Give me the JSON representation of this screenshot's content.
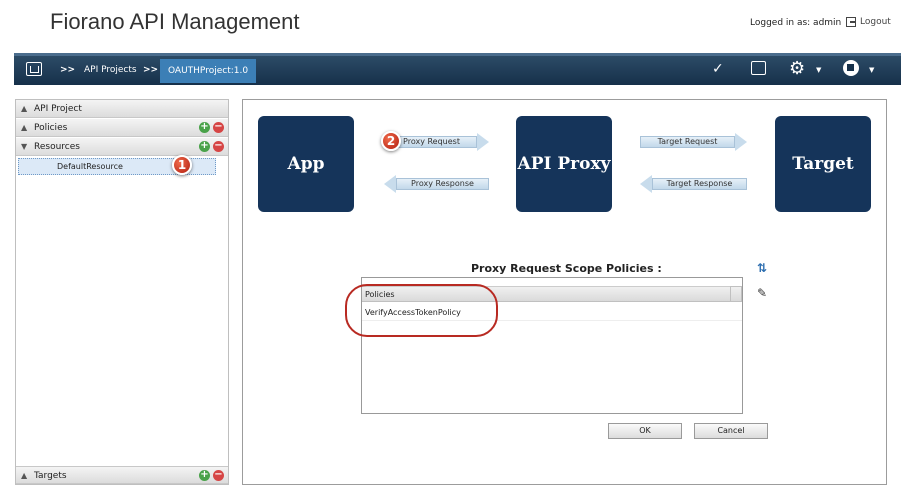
{
  "header": {
    "title": "Fiorano API Management",
    "logged_in": "Logged in as: admin",
    "logout": "Logout"
  },
  "navbar": {
    "crumb_sep": ">>",
    "crumbs": [
      "API Projects"
    ],
    "active_crumb": "OAUTHProject:1.0",
    "icons": [
      "home-icon",
      "validate-icon",
      "save-icon",
      "gear-icon",
      "stop-icon"
    ]
  },
  "left_panel": {
    "sections": [
      {
        "label": "API Project"
      },
      {
        "label": "Policies"
      },
      {
        "label": "Resources"
      },
      {
        "label": "Targets"
      }
    ],
    "resource_item": "DefaultResource",
    "add_symbol": "+",
    "remove_symbol": "−"
  },
  "callouts": {
    "one": "1",
    "two": "2"
  },
  "flow": {
    "app": "App",
    "proxy": "API Proxy",
    "target": "Target",
    "proxy_request": "Proxy Request",
    "proxy_response": "Proxy Response",
    "target_request": "Target Request",
    "target_response": "Target Response"
  },
  "scope": {
    "title": "Proxy Request Scope Policies :",
    "column": "Policies",
    "rows": [
      "VerifyAccessTokenPolicy"
    ]
  },
  "buttons": {
    "ok": "OK",
    "cancel": "Cancel"
  },
  "colors": {
    "navbar": "#1e3a56",
    "flow_box": "#15345a",
    "active_crumb": "#3c7fb6",
    "callout": "#c9301c"
  }
}
